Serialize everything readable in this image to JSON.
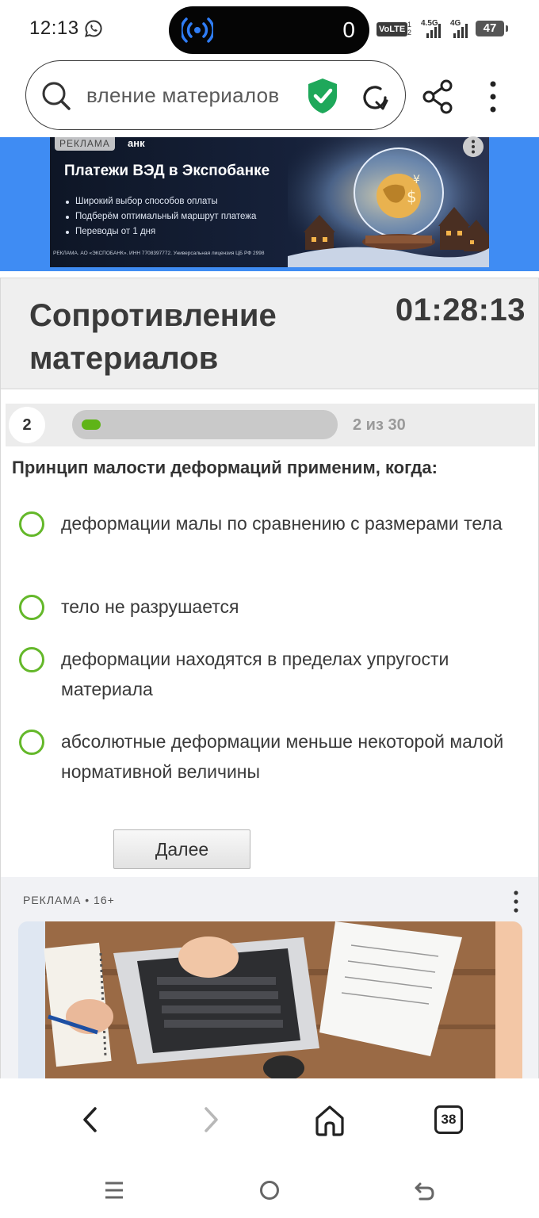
{
  "status_bar": {
    "time": "12:13",
    "island_counter": "0",
    "volte": "VoLTE",
    "sim1_digit": "1",
    "sim2_digit": "2",
    "net_1": "4.5G",
    "net_2": "4G",
    "battery": "47"
  },
  "browser": {
    "url_text": "вление материалов",
    "icons": [
      "search-icon",
      "shield-check-icon",
      "reload-icon",
      "share-icon",
      "menu-dots-icon"
    ]
  },
  "top_ad": {
    "tag": "РЕКЛАМА",
    "brand": "анк",
    "headline": "Платежи ВЭД в Экспобанке",
    "bullets": [
      "Широкий выбор способов оплаты",
      "Подберём оптимальный маршрут платежа",
      "Переводы от 1 дня"
    ],
    "legal": "РЕКЛАМА. АО «ЭКСПОБАНК». ИНН 7708397772. Универсальная лицензия ЦБ РФ 2998"
  },
  "quiz": {
    "title": "Сопротивление материалов",
    "timer": "01:28:13",
    "question_number": "2",
    "progress_text": "2 из 30",
    "progress_fraction": 0.0667,
    "question": "Принцип малости деформаций применим, когда:",
    "answers": [
      {
        "text": "деформации малы по сравнению с размерами тела",
        "selected": false
      },
      {
        "text": "тело не разрушается",
        "selected": false
      },
      {
        "text": "деформации находятся в пределах упругости материала",
        "selected": false
      },
      {
        "text": "абсолютные деформации меньше некоторой малой нормативной величины",
        "selected": false
      }
    ],
    "next_label": "Далее"
  },
  "bottom_ad": {
    "label": "РЕКЛАМА • 16+"
  },
  "nav": {
    "tabs_count": "38"
  },
  "colors": {
    "accent_green": "#64b82a",
    "ad_blue": "#3f8cf3",
    "shield_green": "#1ea85a"
  }
}
